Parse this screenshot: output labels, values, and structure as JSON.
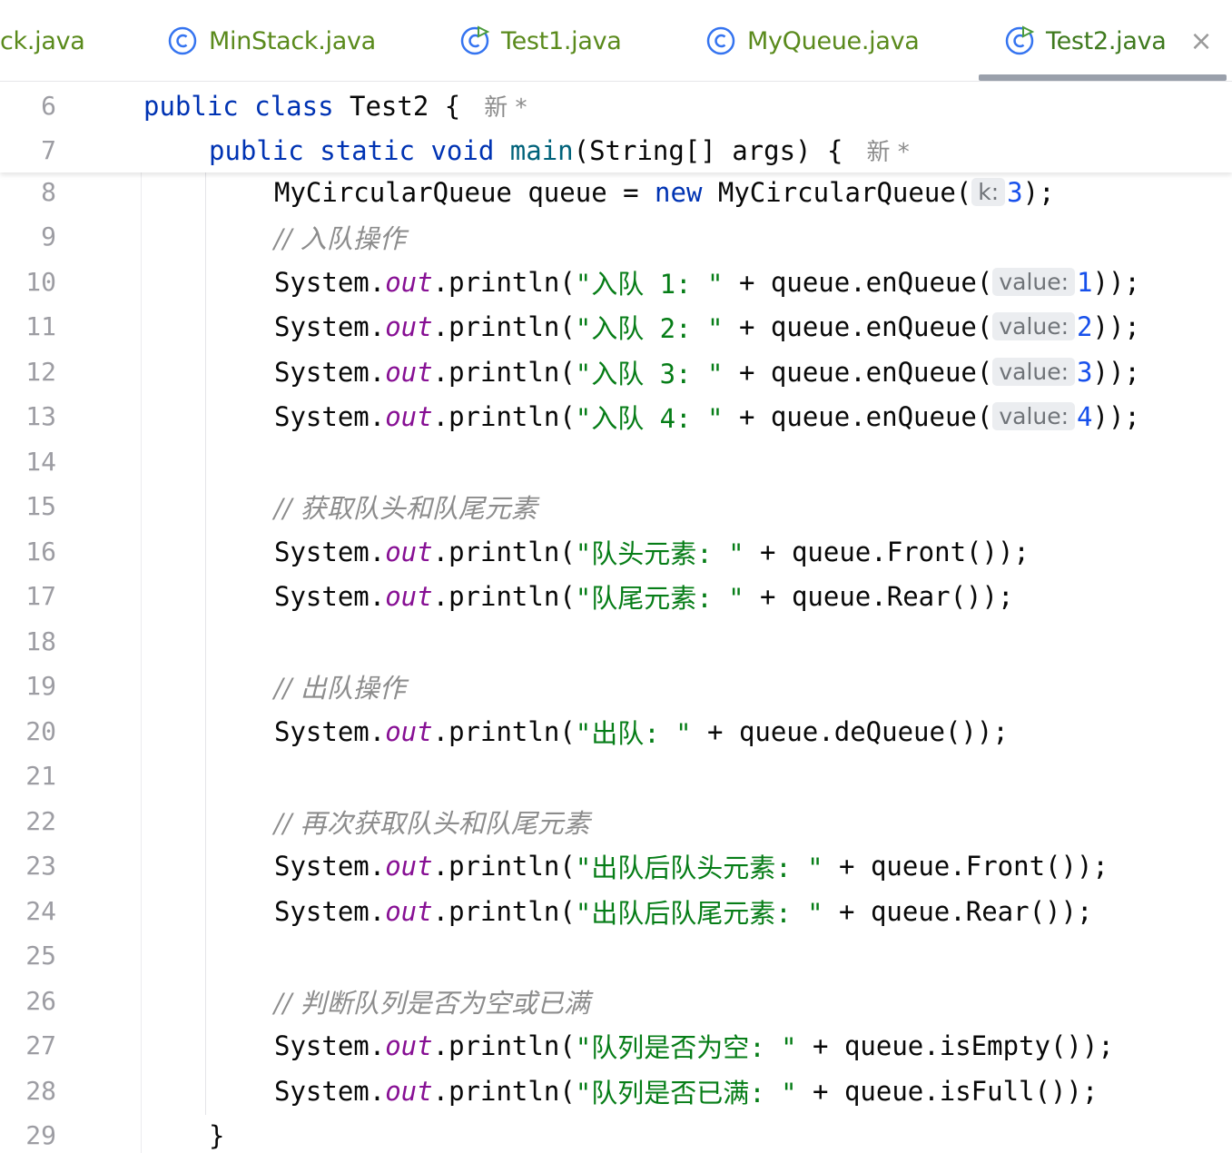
{
  "tabs": [
    {
      "label": "ck.java",
      "icon": "class-icon",
      "active": false
    },
    {
      "label": "MinStack.java",
      "icon": "class-icon",
      "active": false
    },
    {
      "label": "Test1.java",
      "icon": "runnable-class-icon",
      "active": false
    },
    {
      "label": "MyQueue.java",
      "icon": "class-icon",
      "active": false
    },
    {
      "label": "Test2.java",
      "icon": "runnable-class-icon",
      "active": true,
      "close": "×"
    }
  ],
  "colors": {
    "keyword": "#0033b3",
    "string": "#067d17",
    "number": "#1750eb",
    "static_field": "#871094",
    "comment": "#8c8c8c",
    "tab_text": "#5a8a1c"
  },
  "editor": {
    "author_hint": "新 *",
    "lines": {
      "l6": {
        "num": "6",
        "kw1": "public",
        "kw2": "class",
        "name": "Test2",
        "brace": " {"
      },
      "l7": {
        "num": "7",
        "kw1": "public",
        "kw2": "static",
        "kw3": "void",
        "fn": "main",
        "rest": "(String[] args) {"
      },
      "l8": {
        "num": "8",
        "a": "MyCircularQueue queue = ",
        "kw": "new",
        "b": " MyCircularQueue(",
        "hint": "k:",
        "val": "3",
        "c": ");"
      },
      "l9": {
        "num": "9",
        "comment": "// 入队操作"
      },
      "l10": {
        "num": "10",
        "a": "System.",
        "fld": "out",
        "b": ".println(",
        "str": "\"入队 1: \"",
        "c": " + queue.enQueue(",
        "hint": "value:",
        "val": "1",
        "d": "));"
      },
      "l11": {
        "num": "11",
        "a": "System.",
        "fld": "out",
        "b": ".println(",
        "str": "\"入队 2: \"",
        "c": " + queue.enQueue(",
        "hint": "value:",
        "val": "2",
        "d": "));"
      },
      "l12": {
        "num": "12",
        "a": "System.",
        "fld": "out",
        "b": ".println(",
        "str": "\"入队 3: \"",
        "c": " + queue.enQueue(",
        "hint": "value:",
        "val": "3",
        "d": "));"
      },
      "l13": {
        "num": "13",
        "a": "System.",
        "fld": "out",
        "b": ".println(",
        "str": "\"入队 4: \"",
        "c": " + queue.enQueue(",
        "hint": "value:",
        "val": "4",
        "d": "));"
      },
      "l14": {
        "num": "14"
      },
      "l15": {
        "num": "15",
        "comment": "// 获取队头和队尾元素"
      },
      "l16": {
        "num": "16",
        "a": "System.",
        "fld": "out",
        "b": ".println(",
        "str": "\"队头元素: \"",
        "c": " + queue.Front());"
      },
      "l17": {
        "num": "17",
        "a": "System.",
        "fld": "out",
        "b": ".println(",
        "str": "\"队尾元素: \"",
        "c": " + queue.Rear());"
      },
      "l18": {
        "num": "18"
      },
      "l19": {
        "num": "19",
        "comment": "// 出队操作"
      },
      "l20": {
        "num": "20",
        "a": "System.",
        "fld": "out",
        "b": ".println(",
        "str": "\"出队: \"",
        "c": " + queue.deQueue());"
      },
      "l21": {
        "num": "21"
      },
      "l22": {
        "num": "22",
        "comment": "// 再次获取队头和队尾元素"
      },
      "l23": {
        "num": "23",
        "a": "System.",
        "fld": "out",
        "b": ".println(",
        "str": "\"出队后队头元素: \"",
        "c": " + queue.Front());"
      },
      "l24": {
        "num": "24",
        "a": "System.",
        "fld": "out",
        "b": ".println(",
        "str": "\"出队后队尾元素: \"",
        "c": " + queue.Rear());"
      },
      "l25": {
        "num": "25"
      },
      "l26": {
        "num": "26",
        "comment": "// 判断队列是否为空或已满"
      },
      "l27": {
        "num": "27",
        "a": "System.",
        "fld": "out",
        "b": ".println(",
        "str": "\"队列是否为空: \"",
        "c": " + queue.isEmpty());"
      },
      "l28": {
        "num": "28",
        "a": "System.",
        "fld": "out",
        "b": ".println(",
        "str": "\"队列是否已满: \"",
        "c": " + queue.isFull());"
      },
      "l29": {
        "num": "29",
        "a": "}"
      }
    }
  }
}
